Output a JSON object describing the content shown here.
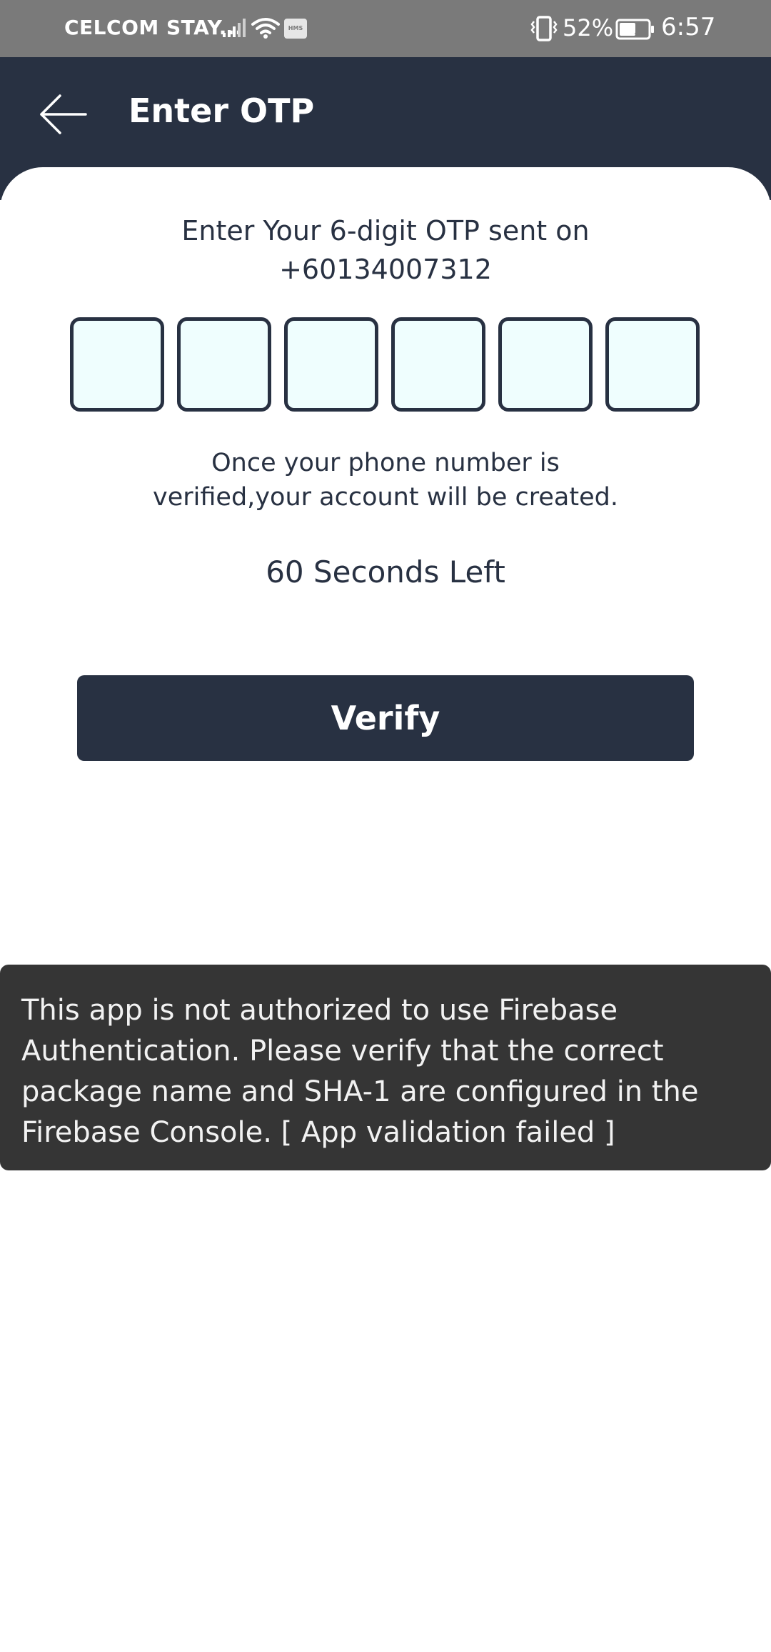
{
  "status_bar": {
    "carrier": "CELCOM STAY...",
    "battery_percent": "52%",
    "time": "6:57",
    "hms_badge": "HMS",
    "icons": [
      "signal-icon",
      "wifi-icon",
      "hms-icon",
      "vibrate-icon",
      "battery-icon"
    ]
  },
  "app_bar": {
    "title": "Enter OTP",
    "back_icon": "back-arrow-icon",
    "background": "#283142"
  },
  "otp": {
    "prompt_line1": "Enter Your 6-digit OTP sent on",
    "prompt_line2": "+60134007312",
    "digits": [
      "",
      "",
      "",
      "",
      "",
      ""
    ]
  },
  "info": {
    "line1": "Once your phone number is",
    "line2": "verified,your account will be created."
  },
  "countdown": {
    "text": "60 Seconds Left"
  },
  "verify_button": {
    "label": "Verify"
  },
  "toast": {
    "line1": "This app is not authorized to use Firebase",
    "line2": "Authentication. Please verify that the correct",
    "line3": "package name and SHA-1 are configured in the",
    "line4": "Firebase Console. [ App validation failed ]"
  },
  "colors": {
    "primary": "#283142",
    "otp_box_fill": "#effefe",
    "status_bar": "#7a7a7a",
    "toast_bg": "#353535"
  }
}
